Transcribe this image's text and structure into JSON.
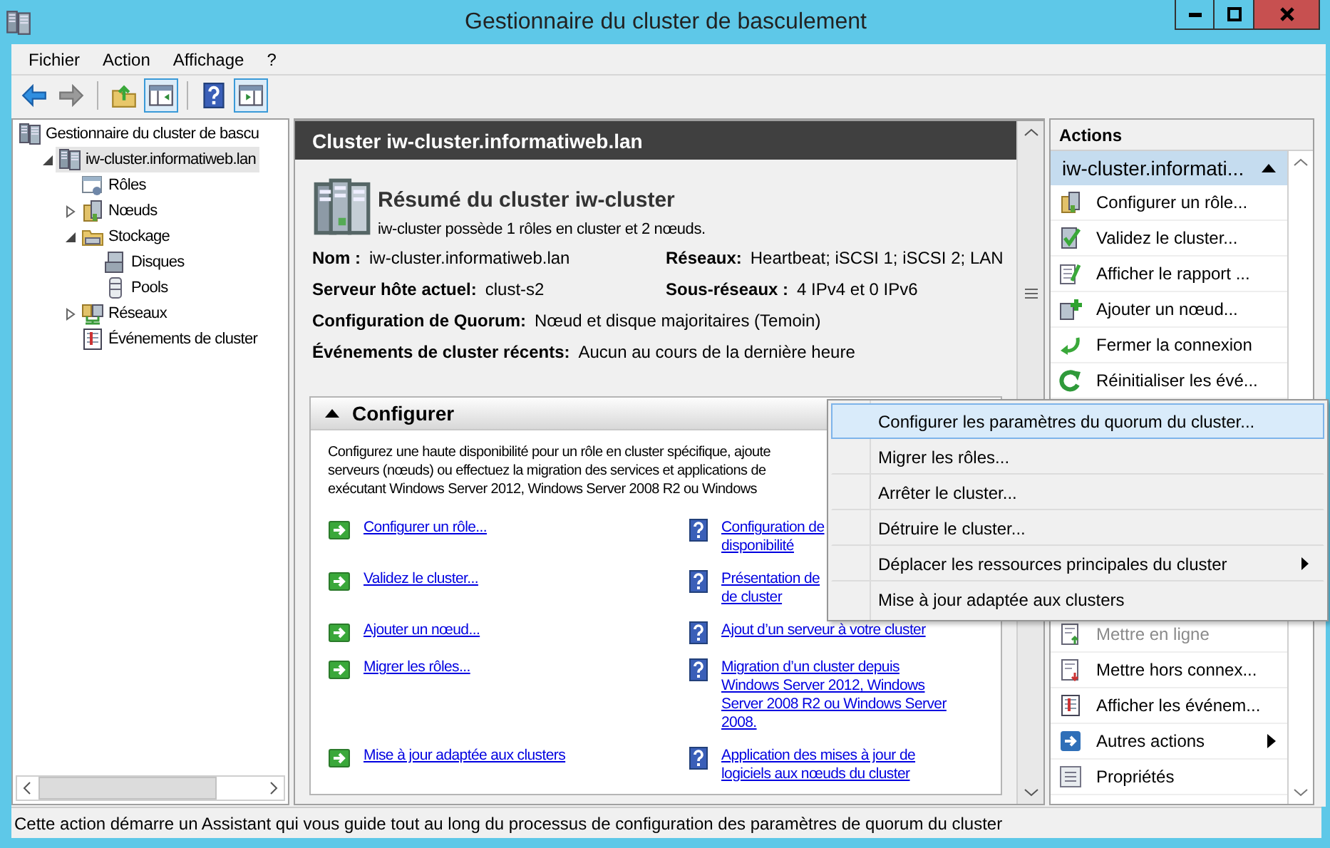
{
  "window": {
    "title": "Gestionnaire du cluster de basculement"
  },
  "menu": [
    "Fichier",
    "Action",
    "Affichage",
    "?"
  ],
  "toolbar": [
    {
      "kind": "back",
      "pressed": false
    },
    {
      "kind": "forward",
      "pressed": false
    },
    {
      "kind": "up",
      "pressed": false
    },
    {
      "kind": "tree",
      "pressed": true
    },
    {
      "kind": "help",
      "pressed": false
    },
    {
      "kind": "pane",
      "pressed": true
    }
  ],
  "tree": [
    {
      "label": "Gestionnaire du cluster de bascu",
      "selected": false,
      "children": [
        {
          "label": "iw-cluster.informatiweb.lan",
          "selected": true,
          "expanded": true,
          "children": [
            {
              "label": "Rôles",
              "selected": false
            },
            {
              "label": "Nœuds",
              "selected": false,
              "expanded": false
            },
            {
              "label": "Stockage",
              "selected": false,
              "expanded": true,
              "children": [
                {
                  "label": "Disques",
                  "selected": false
                },
                {
                  "label": "Pools",
                  "selected": false
                }
              ]
            },
            {
              "label": "Réseaux",
              "selected": false,
              "expanded": false
            },
            {
              "label": "Événements de cluster",
              "selected": false
            }
          ]
        }
      ]
    }
  ],
  "center": {
    "header": "Cluster iw-cluster.informatiweb.lan",
    "summary_title": "Résumé du cluster iw-cluster",
    "summary_text": "iw-cluster possède 1 rôles en cluster et 2 nœuds.",
    "properties": [
      {
        "kind": "half",
        "label": "Nom :",
        "value": "iw-cluster.informatiweb.lan"
      },
      {
        "kind": "half",
        "label": "Réseaux:",
        "value": "Heartbeat; iSCSI 1; iSCSI 2; LAN"
      },
      {
        "kind": "half",
        "label": "Serveur hôte actuel:",
        "value": "clust-s2"
      },
      {
        "kind": "half",
        "label": "Sous-réseaux :",
        "value": "4 IPv4 et 0 IPv6"
      },
      {
        "kind": "full",
        "label": "Configuration de Quorum:",
        "value": "Nœud et disque majoritaires (Temoin)"
      },
      {
        "kind": "full",
        "label": "Événements de cluster récents:",
        "value": "Aucun au cours de la dernière heure"
      }
    ],
    "configure": {
      "title": "Configurer",
      "expanded": true,
      "description_lines": [
        "Configurez une haute disponibilité pour un rôle en cluster spécifique, ajoute",
        "serveurs (nœuds) ou effectuez la migration des services et applications de",
        "exécutant Windows Server 2012, Windows Server 2008 R2 ou Windows"
      ],
      "task_links": [
        "Configurer un rôle...",
        "Validez le cluster...",
        "Ajouter un nœud...",
        "Migrer les rôles...",
        "Mise à jour adaptée aux clusters"
      ],
      "help_links": [
        [
          "Configuration de",
          "disponibilité"
        ],
        [
          "Présentation de",
          "de cluster"
        ],
        [
          "Ajout d’un serveur à votre cluster"
        ],
        [
          "Migration d’un cluster depuis",
          "Windows Server 2012, Windows",
          "Server 2008 R2 ou Windows Server",
          "2008."
        ],
        [
          "Application des mises à jour de",
          "logiciels aux nœuds du cluster"
        ]
      ]
    }
  },
  "actions": {
    "title": "Actions",
    "group": "iw-cluster.informati...",
    "group_expanded": true,
    "upper_items": [
      {
        "label": "Configurer un rôle...",
        "disabled": false,
        "submenu": false
      },
      {
        "label": "Validez le cluster...",
        "disabled": false,
        "submenu": false
      },
      {
        "label": "Afficher le rapport ...",
        "disabled": false,
        "submenu": false
      },
      {
        "label": "Ajouter un nœud...",
        "disabled": false,
        "submenu": false
      },
      {
        "label": "Fermer la connexion",
        "disabled": false,
        "submenu": false
      },
      {
        "label": "Réinitialiser les évé...",
        "disabled": false,
        "submenu": false
      }
    ],
    "lower_items": [
      {
        "label": "Mettre en ligne",
        "disabled": true,
        "submenu": false
      },
      {
        "label": "Mettre hors connex...",
        "disabled": false,
        "submenu": false
      },
      {
        "label": "Afficher les événem...",
        "disabled": false,
        "submenu": false
      },
      {
        "label": "Autres actions",
        "disabled": false,
        "submenu": true
      },
      {
        "label": "Propriétés",
        "disabled": false,
        "submenu": false
      }
    ]
  },
  "context_menu": [
    {
      "label": "Configurer les paramètres du quorum du cluster...",
      "selected": true,
      "submenu": false
    },
    {
      "label": "Migrer les rôles...",
      "selected": false,
      "submenu": false
    },
    {
      "label": "Arrêter le cluster...",
      "selected": false,
      "submenu": false
    },
    {
      "label": "Détruire le cluster...",
      "selected": false,
      "submenu": false
    },
    {
      "label": "Déplacer les ressources principales du cluster",
      "selected": false,
      "submenu": true
    },
    {
      "label": "Mise à jour adaptée aux clusters",
      "selected": false,
      "submenu": false
    }
  ],
  "status_bar": "Cette action démarre un Assistant qui vous guide tout au long du processus de configuration des paramètres de quorum du cluster"
}
